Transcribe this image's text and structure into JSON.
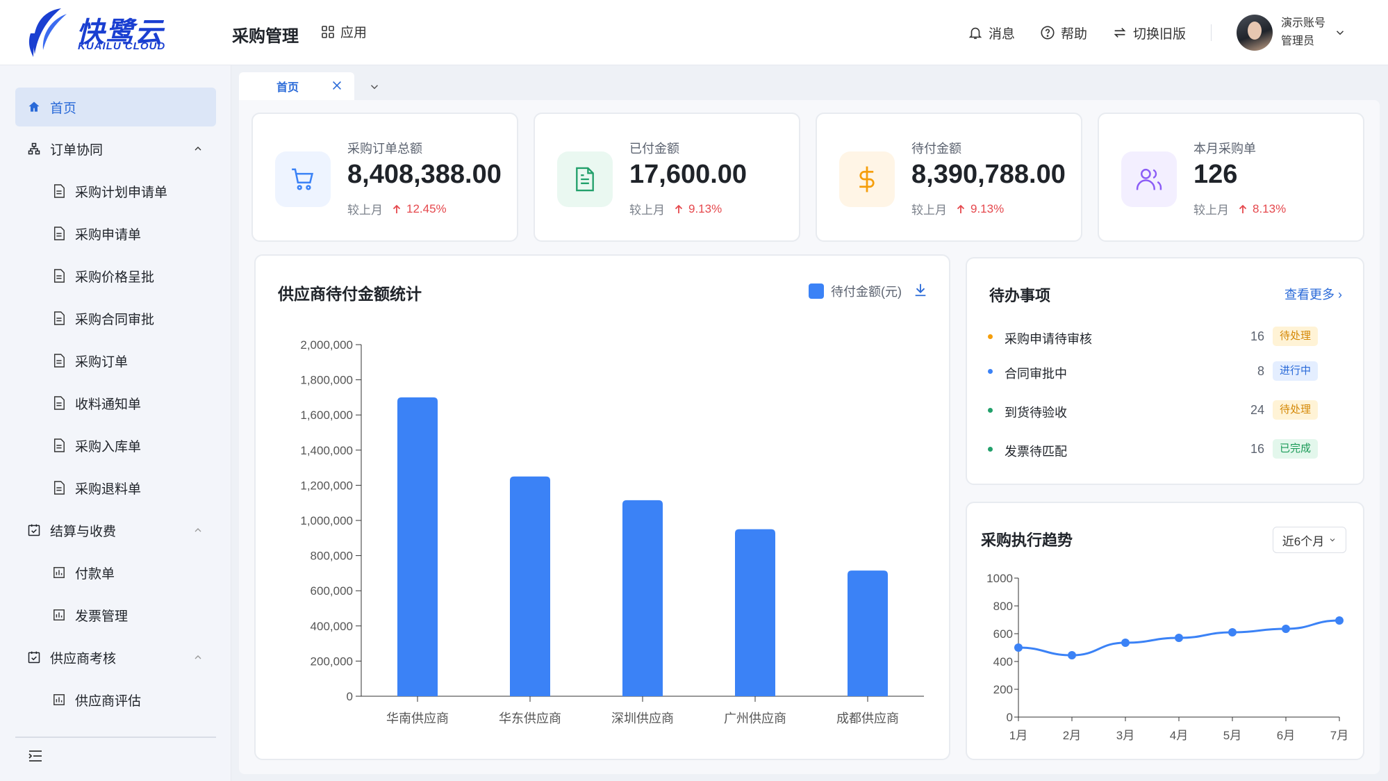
{
  "brand": {
    "name": "快鹭云",
    "sub": "KUAILU CLOUD"
  },
  "header": {
    "system_title": "采购管理",
    "apps_label": "应用",
    "messages": "消息",
    "help": "帮助",
    "switch_old": "切换旧版",
    "user_name": "演示账号",
    "user_role": "管理员"
  },
  "sidebar": {
    "items": [
      {
        "label": "首页",
        "level": 1,
        "icon": "home-icon",
        "active": true
      },
      {
        "label": "订单协同",
        "level": 1,
        "icon": "org-chart-icon",
        "group": true
      },
      {
        "label": "采购计划申请单",
        "level": 2,
        "icon": "document-icon"
      },
      {
        "label": "采购申请单",
        "level": 2,
        "icon": "document-icon"
      },
      {
        "label": "采购价格呈批",
        "level": 2,
        "icon": "document-icon"
      },
      {
        "label": "采购合同审批",
        "level": 2,
        "icon": "document-icon"
      },
      {
        "label": "采购订单",
        "level": 2,
        "icon": "document-icon"
      },
      {
        "label": "收料通知单",
        "level": 2,
        "icon": "document-icon"
      },
      {
        "label": "采购入库单",
        "level": 2,
        "icon": "document-icon"
      },
      {
        "label": "采购退料单",
        "level": 2,
        "icon": "document-icon"
      },
      {
        "label": "结算与收费",
        "level": 1,
        "icon": "calendar-check-icon",
        "group": true
      },
      {
        "label": "付款单",
        "level": 2,
        "icon": "bar-chart-icon"
      },
      {
        "label": "发票管理",
        "level": 2,
        "icon": "bar-chart-icon"
      },
      {
        "label": "供应商考核",
        "level": 1,
        "icon": "calendar-check-icon",
        "group": true
      },
      {
        "label": "供应商评估",
        "level": 2,
        "icon": "bar-chart-icon"
      }
    ]
  },
  "tabs": [
    {
      "label": "首页",
      "active": true
    }
  ],
  "stats": [
    {
      "label": "采购订单总额",
      "value": "8,408,388.00",
      "compare": "较上月",
      "change": "12.45%",
      "icon": "cart-icon",
      "color": "#3b82f6",
      "bg": "#eef4ff"
    },
    {
      "label": "已付金额",
      "value": "17,600.00",
      "compare": "较上月",
      "change": "9.13%",
      "icon": "file-icon",
      "color": "#22a06b",
      "bg": "#eaf8f1"
    },
    {
      "label": "待付金额",
      "value": "8,390,788.00",
      "compare": "较上月",
      "change": "9.13%",
      "icon": "dollar-icon",
      "color": "#f59e0b",
      "bg": "#fff5e6"
    },
    {
      "label": "本月采购单",
      "value": "126",
      "compare": "较上月",
      "change": "8.13%",
      "icon": "users-icon",
      "color": "#8b5cf6",
      "bg": "#f3efff"
    }
  ],
  "supplier_chart": {
    "title": "供应商待付金额统计",
    "legend": "待付金额(元)",
    "color": "#3b82f6",
    "chart_data": {
      "type": "bar",
      "categories": [
        "华南供应商",
        "华东供应商",
        "深圳供应商",
        "广州供应商",
        "成都供应商"
      ],
      "values": [
        1700000,
        1250000,
        1115000,
        950000,
        715000
      ],
      "ylim": [
        0,
        2000000
      ],
      "yticks": [
        "0",
        "200,000",
        "400,000",
        "600,000",
        "800,000",
        "1,000,000",
        "1,200,000",
        "1,400,000",
        "1,600,000",
        "1,800,000",
        "2,000,000"
      ],
      "grid": false
    }
  },
  "todo": {
    "title": "待办事项",
    "more": "查看更多 ›",
    "items": [
      {
        "label": "采购申请待审核",
        "count": "16",
        "badge": "待处理",
        "dot": "#f59e0b",
        "badge_bg": "#fff3d6",
        "badge_fg": "#d48806"
      },
      {
        "label": "合同审批中",
        "count": "8",
        "badge": "进行中",
        "dot": "#3b82f6",
        "badge_bg": "#e4eeff",
        "badge_fg": "#2a6ad8"
      },
      {
        "label": "到货待验收",
        "count": "24",
        "badge": "待处理",
        "dot": "#22a06b",
        "badge_bg": "#fff3d6",
        "badge_fg": "#d48806"
      },
      {
        "label": "发票待匹配",
        "count": "16",
        "badge": "已完成",
        "dot": "#22a06b",
        "badge_bg": "#e3f7ec",
        "badge_fg": "#1a9a57"
      }
    ]
  },
  "trend": {
    "title": "采购执行趋势",
    "range": "近6个月",
    "color": "#3b82f6",
    "chart_data": {
      "type": "line",
      "x": [
        "1月",
        "2月",
        "3月",
        "4月",
        "5月",
        "6月",
        "7月"
      ],
      "values": [
        500,
        445,
        535,
        570,
        610,
        635,
        695
      ],
      "ylim": [
        0,
        1000
      ],
      "yticks": [
        "0",
        "200",
        "400",
        "600",
        "800",
        "1000"
      ],
      "grid": false
    }
  }
}
